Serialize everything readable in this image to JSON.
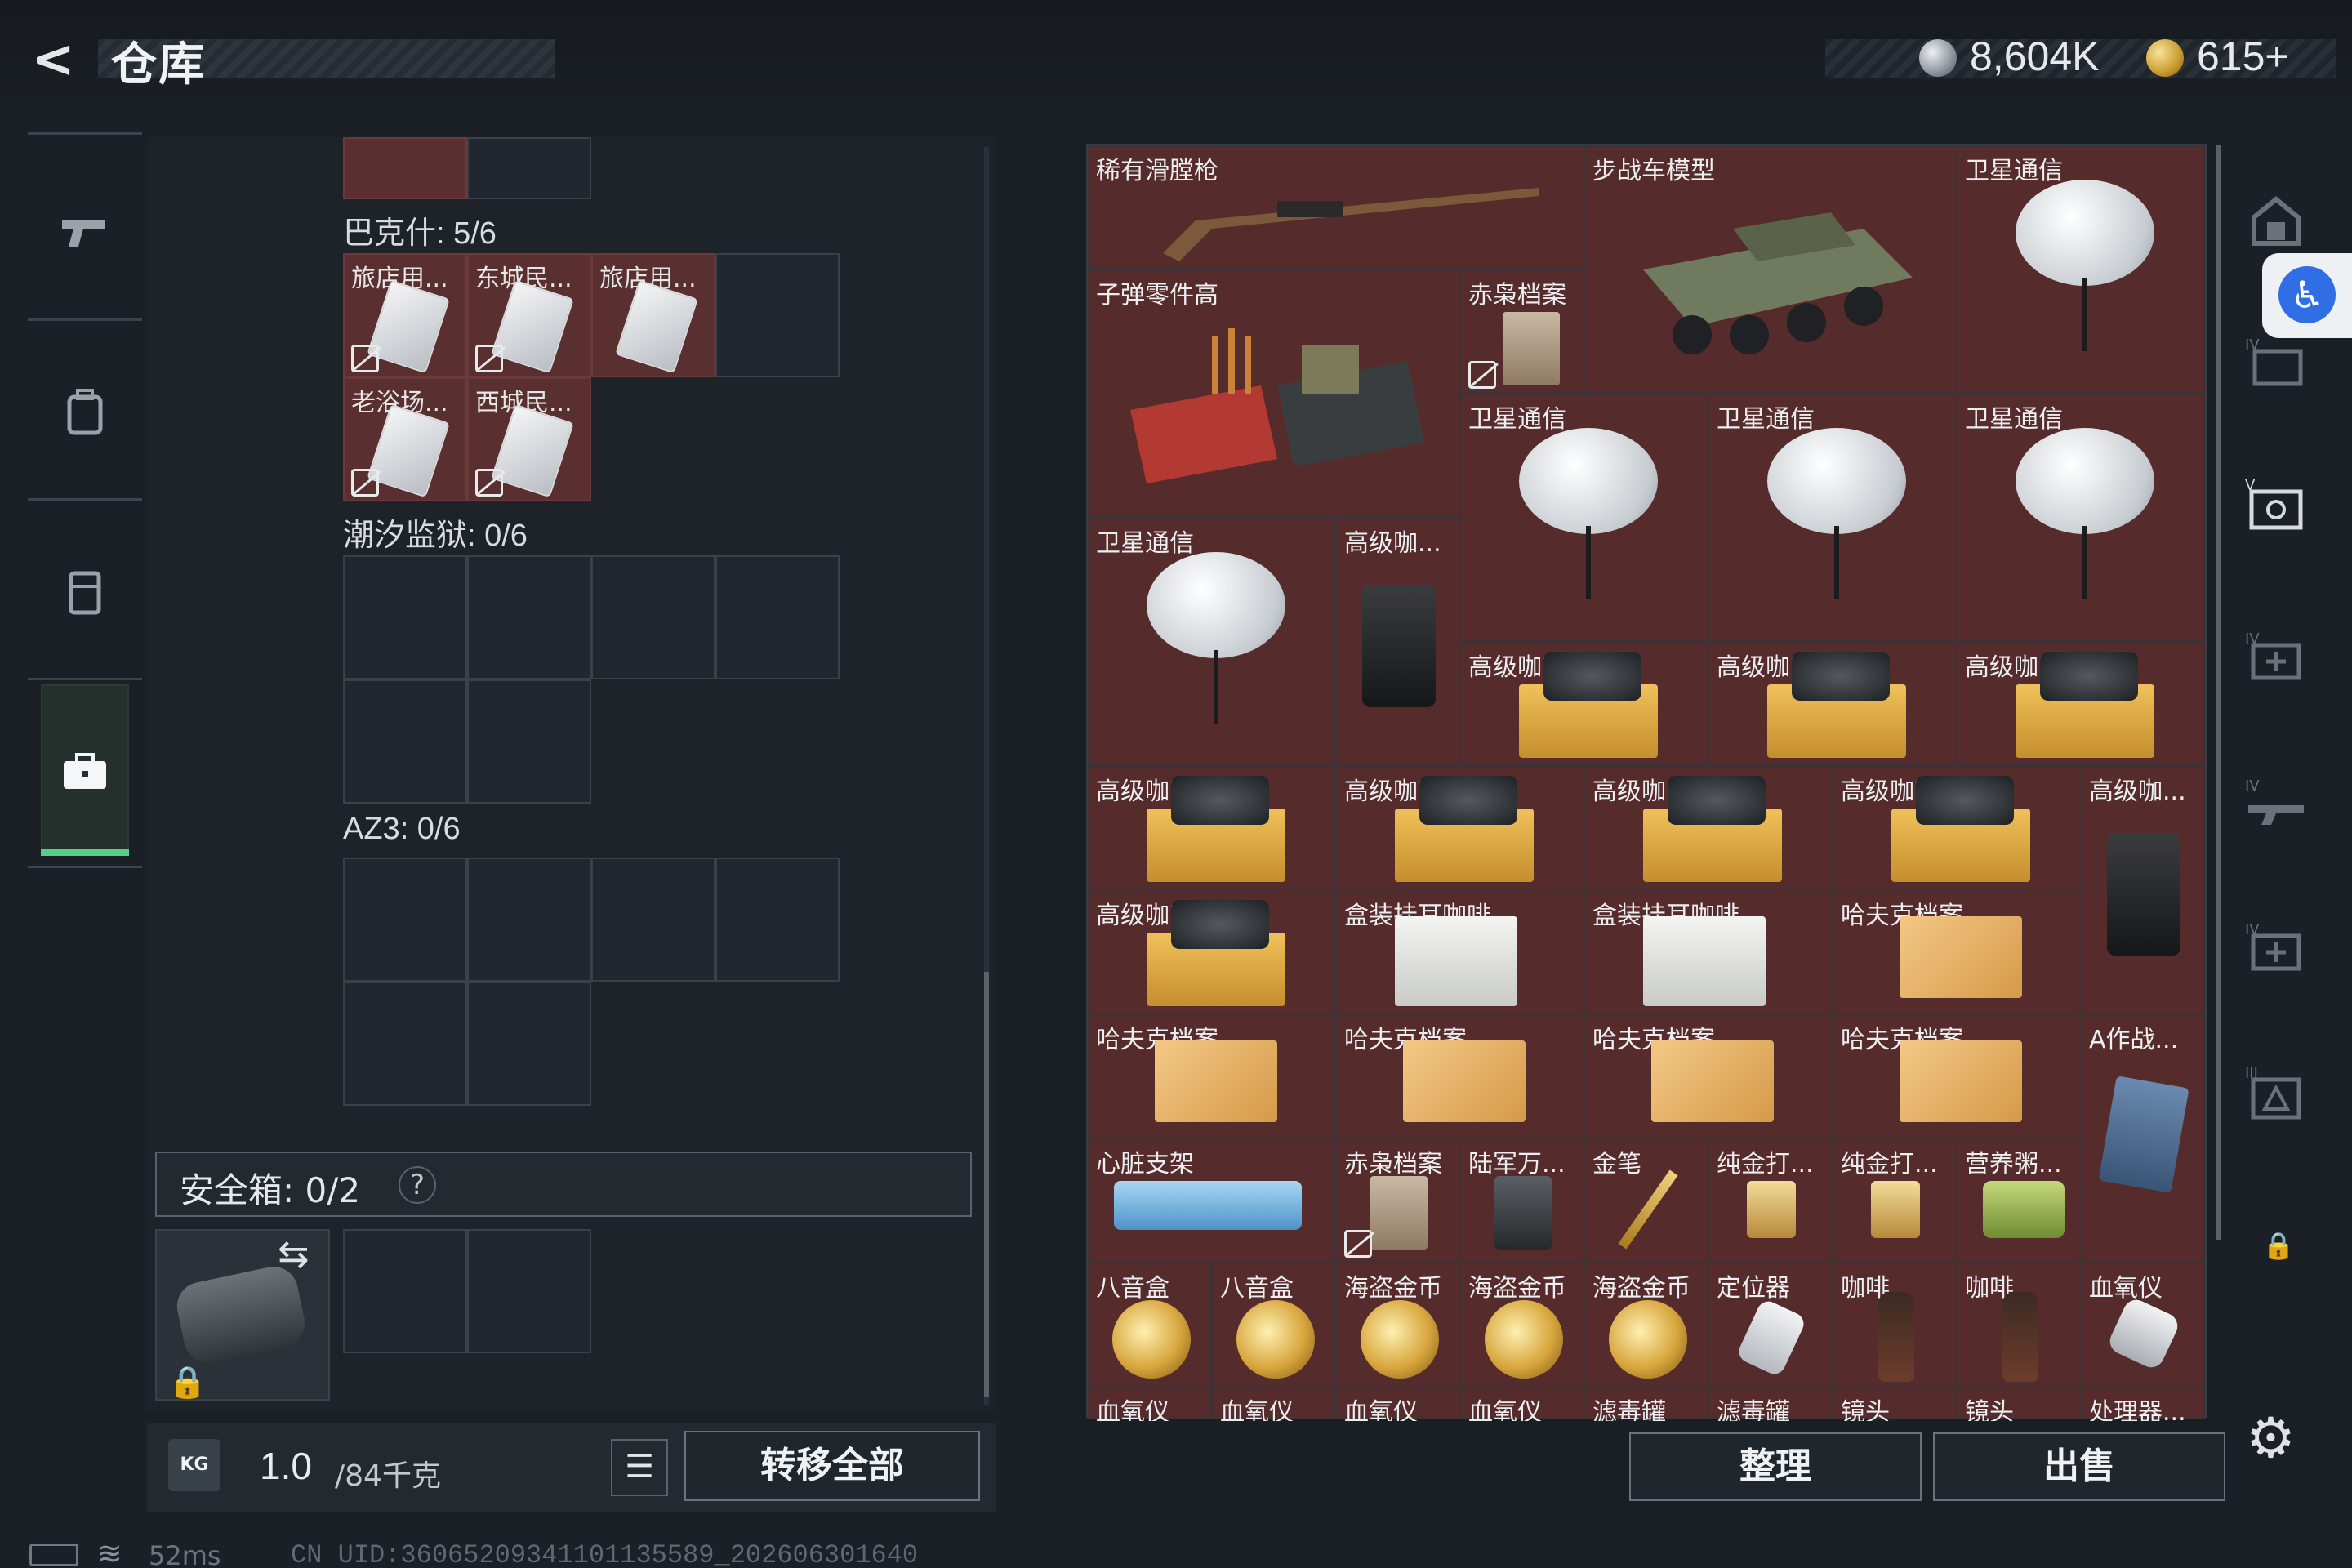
{
  "header": {
    "back_label": "<",
    "title": "仓库",
    "silver_value": "8,604K",
    "gold_value": "615+"
  },
  "left_nav": {
    "items": [
      {
        "name": "weapon",
        "icon": "pistol-icon"
      },
      {
        "name": "backpack",
        "icon": "backpack-icon"
      },
      {
        "name": "armor",
        "icon": "vest-icon"
      },
      {
        "name": "storage",
        "icon": "briefcase-icon",
        "active": true
      }
    ]
  },
  "left_panel": {
    "section1": {
      "label": "巴克什: 5/6",
      "cells": [
        {
          "label": "旅店用...",
          "locked": true
        },
        {
          "label": "东城民...",
          "locked": true
        },
        {
          "label": "旅店用...",
          "locked": false
        },
        {
          "label": "老浴场...",
          "locked": true
        },
        {
          "label": "西城民...",
          "locked": true
        }
      ]
    },
    "section2": {
      "label": "潮汐监狱: 0/6"
    },
    "section3": {
      "label": "AZ3: 0/6"
    },
    "safebox": {
      "label": "安全箱: 0/2",
      "help": "?"
    },
    "weight": {
      "value": "1.0",
      "max": "/84千克",
      "icon_label": "KG"
    },
    "transfer_all": "转移全部",
    "list_icon": "☰"
  },
  "status_bar": {
    "ping": "52ms",
    "uid": "CN UID:3606520934110113558​9_202606301640"
  },
  "grid": {
    "items": [
      {
        "label": "稀有滑膛枪"
      },
      {
        "label": "步战车模型"
      },
      {
        "label": "卫星通信"
      },
      {
        "label": "子弹零件高"
      },
      {
        "label": "赤枭档案"
      },
      {
        "label": "卫星通信"
      },
      {
        "label": "卫星通信"
      },
      {
        "label": "卫星通信"
      },
      {
        "label": "卫星通信"
      },
      {
        "label": "高级咖..."
      },
      {
        "label": "高级咖啡豆"
      },
      {
        "label": "高级咖啡豆"
      },
      {
        "label": "高级咖啡豆"
      },
      {
        "label": "高级咖啡豆"
      },
      {
        "label": "高级咖啡豆"
      },
      {
        "label": "高级咖啡豆"
      },
      {
        "label": "高级咖啡豆"
      },
      {
        "label": "高级咖..."
      },
      {
        "label": "高级咖啡豆"
      },
      {
        "label": "盒装挂耳咖啡"
      },
      {
        "label": "盒装挂耳咖啡"
      },
      {
        "label": "哈夫克档案"
      },
      {
        "label": "哈夫克档案"
      },
      {
        "label": "哈夫克档案"
      },
      {
        "label": "哈夫克档案"
      },
      {
        "label": "哈夫克档案"
      },
      {
        "label": "A作战..."
      },
      {
        "label": "心脏支架"
      },
      {
        "label": "赤枭档案"
      },
      {
        "label": "陆军万..."
      },
      {
        "label": "金笔"
      },
      {
        "label": "纯金打..."
      },
      {
        "label": "纯金打..."
      },
      {
        "label": "营养粥..."
      },
      {
        "label": "八音盒"
      },
      {
        "label": "八音盒"
      },
      {
        "label": "海盗金币"
      },
      {
        "label": "海盗金币"
      },
      {
        "label": "海盗金币"
      },
      {
        "label": "定位器"
      },
      {
        "label": "咖啡"
      },
      {
        "label": "咖啡"
      },
      {
        "label": "血氧仪"
      },
      {
        "label": "血氧仪"
      },
      {
        "label": "血氧仪"
      },
      {
        "label": "血氧仪"
      },
      {
        "label": "血氧仪"
      },
      {
        "label": "滤毒罐"
      },
      {
        "label": "滤毒罐"
      },
      {
        "label": "镜头"
      },
      {
        "label": "镜头"
      },
      {
        "label": "处理器..."
      }
    ],
    "sort_label": "整理",
    "sell_label": "出售"
  },
  "side_nav": {
    "icons": [
      "storage-home-icon",
      "tier4-folder-icon",
      "tier5-safe-icon",
      "tier4-medkit-icon",
      "tier4-weapon-icon",
      "tier4-medkit2-icon",
      "tier3-triangle-icon"
    ],
    "lock": "🔒",
    "gear": "⚙"
  },
  "colors": {
    "item_bg": "#562b2c",
    "accent_green": "#55d08a",
    "accessibility_blue": "#2f6ee4"
  }
}
